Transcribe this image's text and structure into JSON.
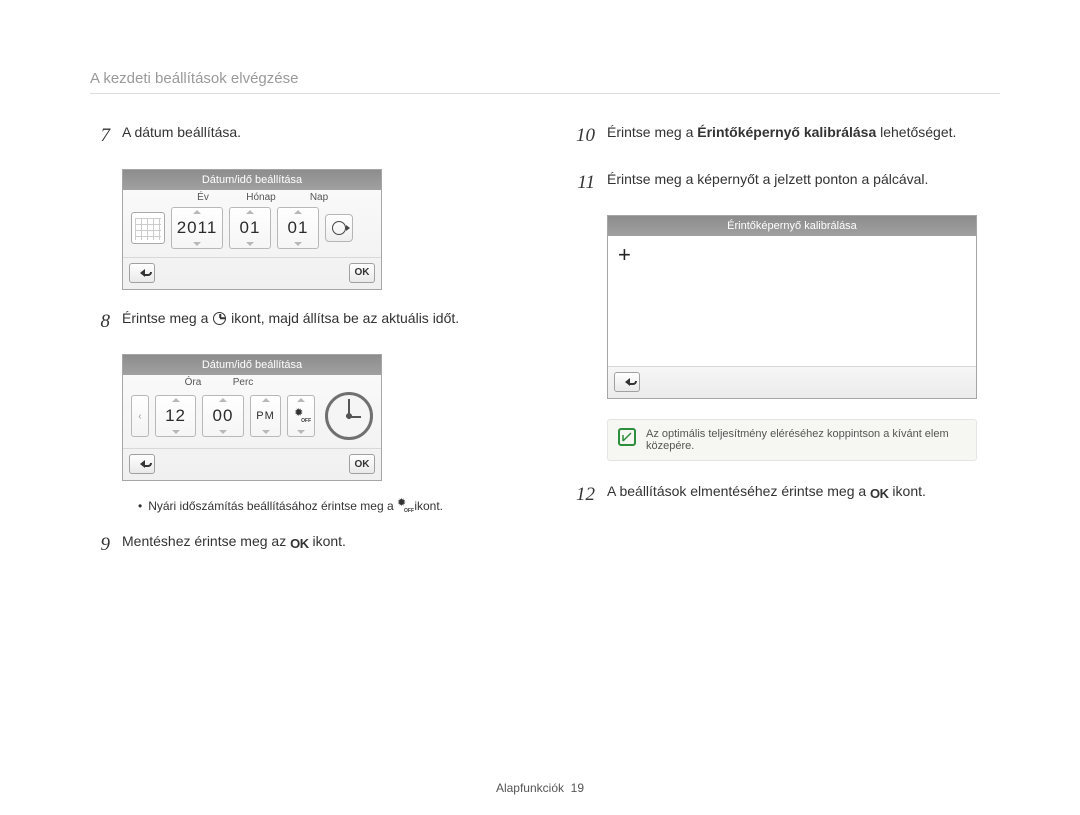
{
  "page": {
    "header": "A kezdeti beállítások elvégzése",
    "footer_label": "Alapfunkciók",
    "footer_page": "19"
  },
  "steps": {
    "s7": {
      "num": "7",
      "text": "A dátum beállítása."
    },
    "s8": {
      "num": "8",
      "pre": "Érintse meg a ",
      "post": " ikont, majd állítsa be az aktuális időt."
    },
    "s9": {
      "num": "9",
      "pre": "Mentéshez érintse meg az ",
      "post": " ikont."
    },
    "s10": {
      "num": "10",
      "pre": "Érintse meg a ",
      "bold": "Érintőképernyő kalibrálása",
      "post": " lehetőséget."
    },
    "s11": {
      "num": "11",
      "text": "Érintse meg a képernyőt a jelzett ponton a pálcával."
    },
    "s12": {
      "num": "12",
      "pre": "A beállítások elmentéséhez érintse meg a ",
      "post": " ikont."
    }
  },
  "note_dst": {
    "pre": "Nyári időszámítás beállításához érintse meg a ",
    "post": " ikont."
  },
  "tip": {
    "text": "Az optimális teljesítmény eléréséhez koppintson a kívánt elem közepére."
  },
  "date_panel": {
    "title": "Dátum/idő beállítása",
    "labels": {
      "year": "Év",
      "month": "Hónap",
      "day": "Nap"
    },
    "values": {
      "year": "2011",
      "month": "01",
      "day": "01"
    },
    "ok": "OK"
  },
  "time_panel": {
    "title": "Dátum/idő beállítása",
    "labels": {
      "hour": "Óra",
      "minute": "Perc"
    },
    "values": {
      "hour": "12",
      "minute": "00",
      "ampm": "PM"
    },
    "ok": "OK"
  },
  "calib_panel": {
    "title": "Érintőképernyő kalibrálása"
  },
  "ok_glyph": "OK"
}
